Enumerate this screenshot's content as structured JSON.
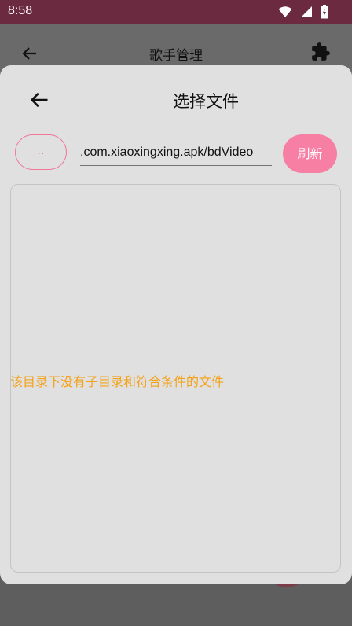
{
  "status_bar": {
    "time": "8:58",
    "icons": [
      "wifi-icon",
      "signal-icon",
      "battery-icon"
    ]
  },
  "background_screen": {
    "title": "歌手管理",
    "back_icon": "arrow-left-icon",
    "action_icon": "puzzle-piece-icon"
  },
  "dialog": {
    "title": "选择文件",
    "back_icon": "arrow-left-icon",
    "up_button_label": "..",
    "path_value": ".com.xiaoxingxing.apk/bdVideo",
    "refresh_label": "刷新",
    "empty_message": "该目录下没有子目录和符合条件的文件"
  },
  "colors": {
    "accent_pink": "#f77fa3",
    "outline_pink": "#f07898",
    "status_bar": "#6b2a3f",
    "empty_text_orange": "#f4a21a",
    "dialog_bg": "#e0e0e0"
  }
}
